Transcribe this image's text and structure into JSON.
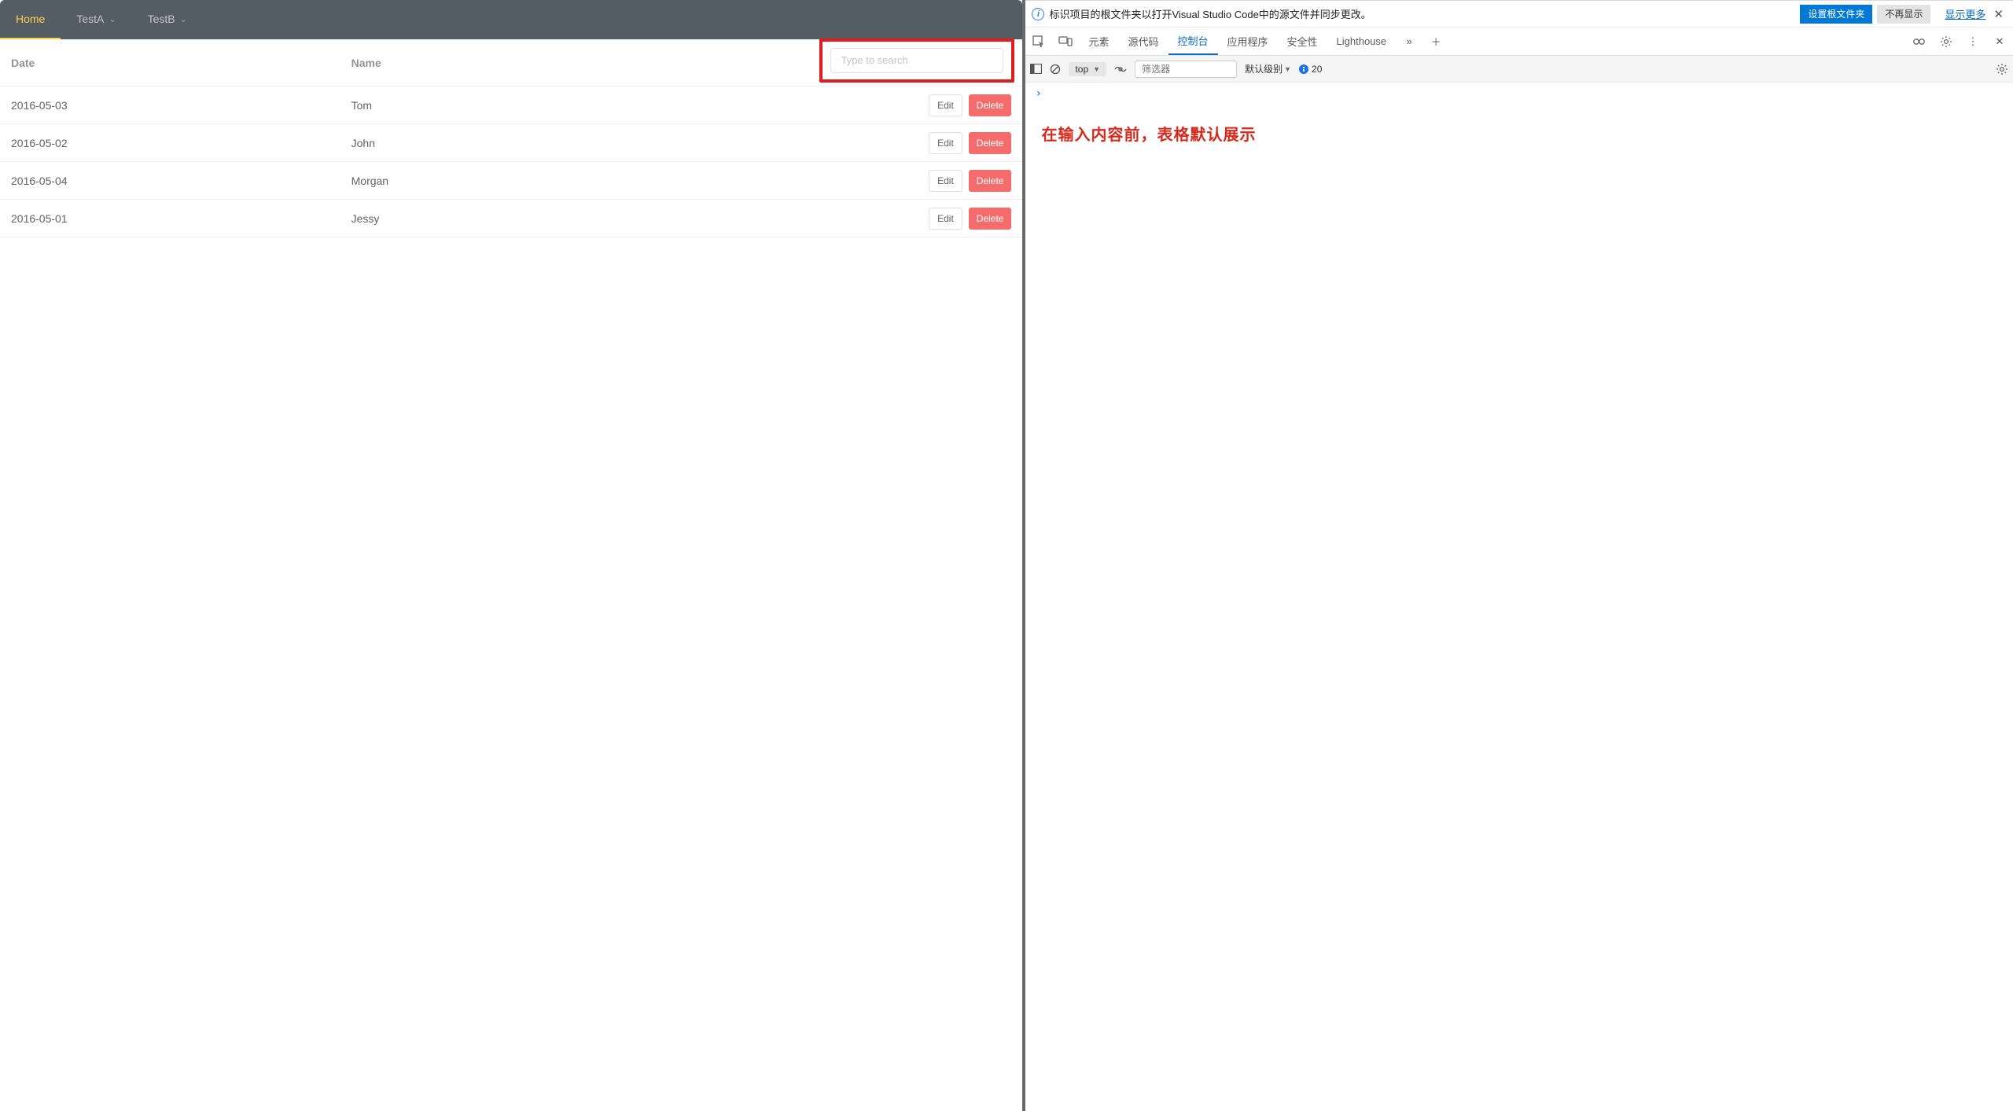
{
  "nav": {
    "items": [
      {
        "label": "Home",
        "active": true,
        "dropdown": false
      },
      {
        "label": "TestA",
        "active": false,
        "dropdown": true
      },
      {
        "label": "TestB",
        "active": false,
        "dropdown": true
      }
    ]
  },
  "table": {
    "col_date": "Date",
    "col_name": "Name",
    "search_placeholder": "Type to search",
    "edit_label": "Edit",
    "delete_label": "Delete",
    "rows": [
      {
        "date": "2016-05-03",
        "name": "Tom"
      },
      {
        "date": "2016-05-02",
        "name": "John"
      },
      {
        "date": "2016-05-04",
        "name": "Morgan"
      },
      {
        "date": "2016-05-01",
        "name": "Jessy"
      }
    ]
  },
  "devtools": {
    "infobar": {
      "message": "标识项目的根文件夹以打开Visual Studio Code中的源文件并同步更改。",
      "set_root": "设置根文件夹",
      "no_show": "不再显示",
      "show_more": "显示更多"
    },
    "tabs": {
      "elements": "元素",
      "sources": "源代码",
      "console": "控制台",
      "application": "应用程序",
      "security": "安全性",
      "lighthouse": "Lighthouse"
    },
    "toolbar": {
      "context": "top",
      "filter_placeholder": "筛选器",
      "level_label": "默认级别",
      "message_count": "20"
    },
    "console_output": "在输入内容前，表格默认展示"
  }
}
